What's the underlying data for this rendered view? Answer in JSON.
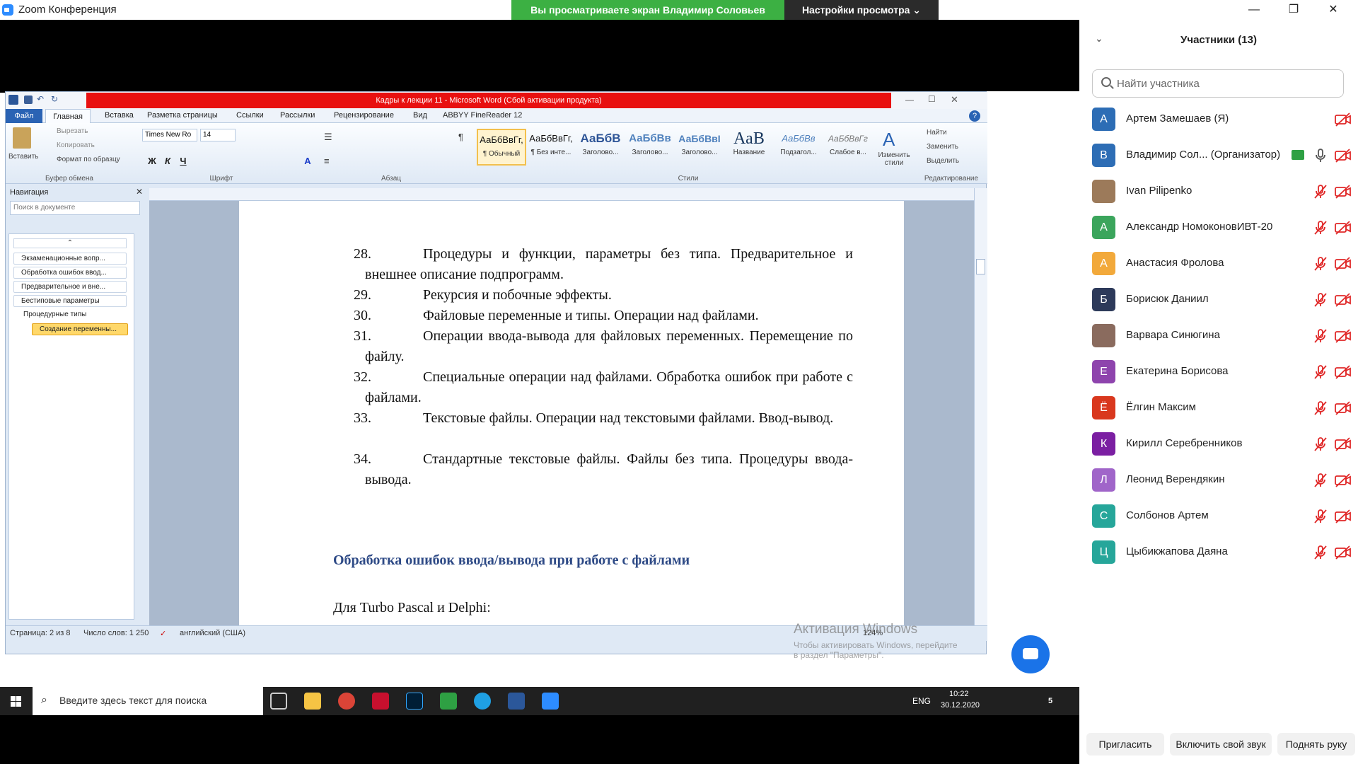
{
  "zoom": {
    "app_title": "Zoom Конференция",
    "share_banner": "Вы просматриваете экран Владимир Соловьев",
    "view_options": "Настройки просмотра ⌄",
    "window_controls": [
      "—",
      "❐",
      "✕"
    ]
  },
  "word": {
    "title": "Кадры к лекции 11 - Microsoft Word (Сбой активации продукта)",
    "tabs": [
      "Файл",
      "Главная",
      "Вставка",
      "Разметка страницы",
      "Ссылки",
      "Рассылки",
      "Рецензирование",
      "Вид",
      "ABBYY FineReader 12"
    ],
    "clipboard": {
      "paste": "Вставить",
      "cut": "Вырезать",
      "copy": "Копировать",
      "format_painter": "Формат по образцу",
      "group": "Буфер обмена"
    },
    "font": {
      "name": "Times New Ro",
      "size": "14",
      "group": "Шрифт"
    },
    "paragraph_group": "Абзац",
    "styles": {
      "group": "Стили",
      "items": [
        {
          "sample": "АаБбВвГг,",
          "name": "¶ Обычный"
        },
        {
          "sample": "АаБбВвГг,",
          "name": "¶ Без инте..."
        },
        {
          "sample": "АаБбВ",
          "name": "Заголово..."
        },
        {
          "sample": "АаБбВв",
          "name": "Заголово..."
        },
        {
          "sample": "АаБбВвІ",
          "name": "Заголово..."
        },
        {
          "sample": "АаВ",
          "name": "Название"
        },
        {
          "sample": "АаБбВв",
          "name": "Подзагол..."
        },
        {
          "sample": "АаБбВвГг",
          "name": "Слабое в..."
        }
      ],
      "change_styles": "Изменить стили"
    },
    "editing": {
      "find": "Найти",
      "replace": "Заменить",
      "select": "Выделить",
      "group": "Редактирование"
    },
    "navigation": {
      "header": "Навигация",
      "search_placeholder": "Поиск в документе",
      "items": [
        "Экзаменационные вопр...",
        "Обработка ошибок ввод...",
        "Предварительное и вне...",
        "Бестиповые параметры",
        "Процедурные типы",
        "Создание переменны..."
      ]
    },
    "document": {
      "questions": [
        {
          "num": "28.",
          "text": "Процедуры и функции, параметры без типа. Предварительное и внешнее описание подпрограмм."
        },
        {
          "num": "29.",
          "text": "Рекурсия и побочные эффекты."
        },
        {
          "num": "30.",
          "text": "Файловые переменные и типы. Операции над файлами."
        },
        {
          "num": "31.",
          "text": "Операции ввода-вывода для файловых переменных. Перемещение по файлу."
        },
        {
          "num": "32.",
          "text": "Специальные операции над файлами. Обработка ошибок при работе с файлами."
        },
        {
          "num": "33.",
          "text": "Текстовые файлы. Операции над текстовыми файлами. Ввод-вывод."
        },
        {
          "num": "34.",
          "text": "Стандартные текстовые файлы. Файлы без типа. Процедуры ввода-вывода."
        }
      ],
      "heading": "Обработка ошибок ввода/вывода при работе с файлами",
      "line": "Для Turbo Pascal и  Delphi:"
    },
    "status": {
      "page": "Страница: 2 из 8",
      "words": "Число слов: 1 250",
      "language": "английский (США)",
      "zoom": "124%"
    }
  },
  "activation": {
    "title": "Активация Windows",
    "subtitle": "Чтобы активировать Windows, перейдите в раздел \"Параметры\"."
  },
  "taskbar": {
    "search": "Введите здесь текст для поиска",
    "lang": "ENG",
    "time": "10:22",
    "date": "30.12.2020",
    "notifications": "5"
  },
  "participants": {
    "title": "Участники (13)",
    "search_placeholder": "Найти участника",
    "list": [
      {
        "initial": "А",
        "name": "Артем Замешаев (Я)",
        "color": "#2D6DB5"
      },
      {
        "initial": "В",
        "name": "Владимир Сол... (Организатор)",
        "color": "#2D6DB5"
      },
      {
        "initial": "",
        "name": "Ivan Pilipenko",
        "color": "#9c7a5a"
      },
      {
        "initial": "А",
        "name": "Александр НомоконовИВТ-20",
        "color": "#3BA55C"
      },
      {
        "initial": "А",
        "name": "Анастасия Фролова",
        "color": "#F2A93B"
      },
      {
        "initial": "Б",
        "name": "Борисюк Даниил",
        "color": "#2D3A5A"
      },
      {
        "initial": "",
        "name": "Варвара Синюгина",
        "color": "#8a6b5e"
      },
      {
        "initial": "Е",
        "name": "Екатерина Борисова",
        "color": "#8E44AD"
      },
      {
        "initial": "Ё",
        "name": "Ёлгин Максим",
        "color": "#D9381E"
      },
      {
        "initial": "К",
        "name": "Кирилл Серебренников",
        "color": "#7B1FA2"
      },
      {
        "initial": "Л",
        "name": "Леонид Верендякин",
        "color": "#A065C9"
      },
      {
        "initial": "С",
        "name": "Солбонов Артем",
        "color": "#26A69A"
      },
      {
        "initial": "Ц",
        "name": "Цыбикжапова Даяна",
        "color": "#26A69A"
      }
    ],
    "buttons": [
      "Пригласить",
      "Включить свой звук",
      "Поднять руку"
    ]
  }
}
